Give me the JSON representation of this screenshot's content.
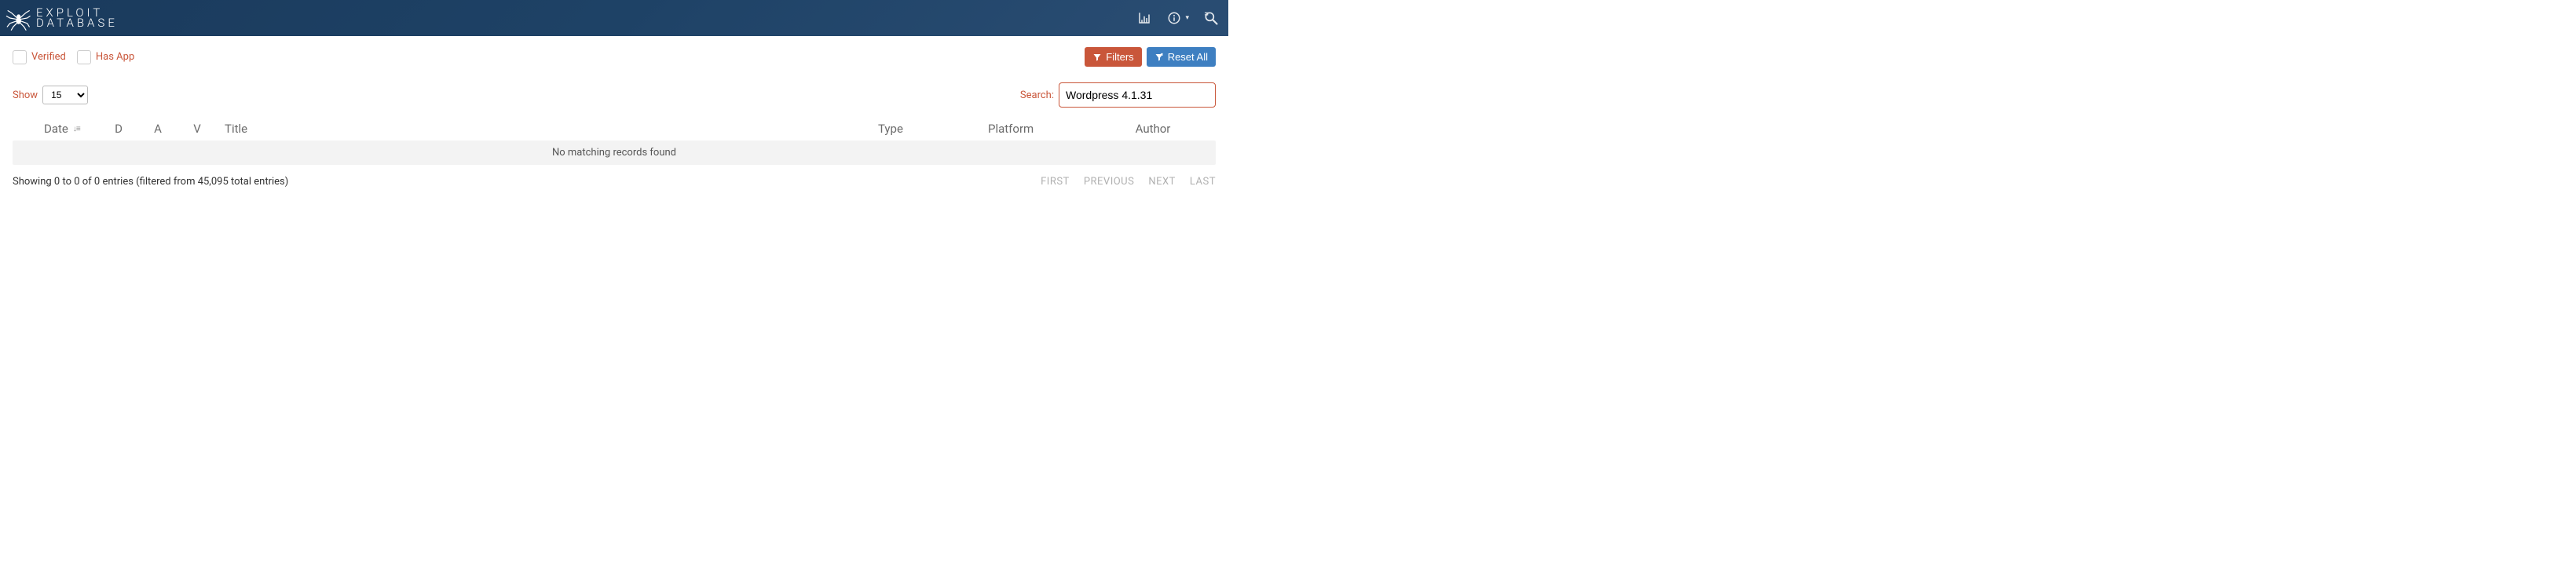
{
  "brand": {
    "line1": "EXPLOIT",
    "line2": "DATABASE"
  },
  "filters": {
    "verified_label": "Verified",
    "hasapp_label": "Has App",
    "filters_btn": "Filters",
    "reset_btn": "Reset All"
  },
  "controls": {
    "show_label": "Show",
    "show_value": "15",
    "search_label": "Search:",
    "search_value": "Wordpress 4.1.31"
  },
  "columns": {
    "date": "Date",
    "d": "D",
    "a": "A",
    "v": "V",
    "title": "Title",
    "type": "Type",
    "platform": "Platform",
    "author": "Author"
  },
  "table": {
    "empty_msg": "No matching records found"
  },
  "footer": {
    "info": "Showing 0 to 0 of 0 entries (filtered from 45,095 total entries)",
    "first": "FIRST",
    "previous": "PREVIOUS",
    "next": "NEXT",
    "last": "LAST"
  }
}
